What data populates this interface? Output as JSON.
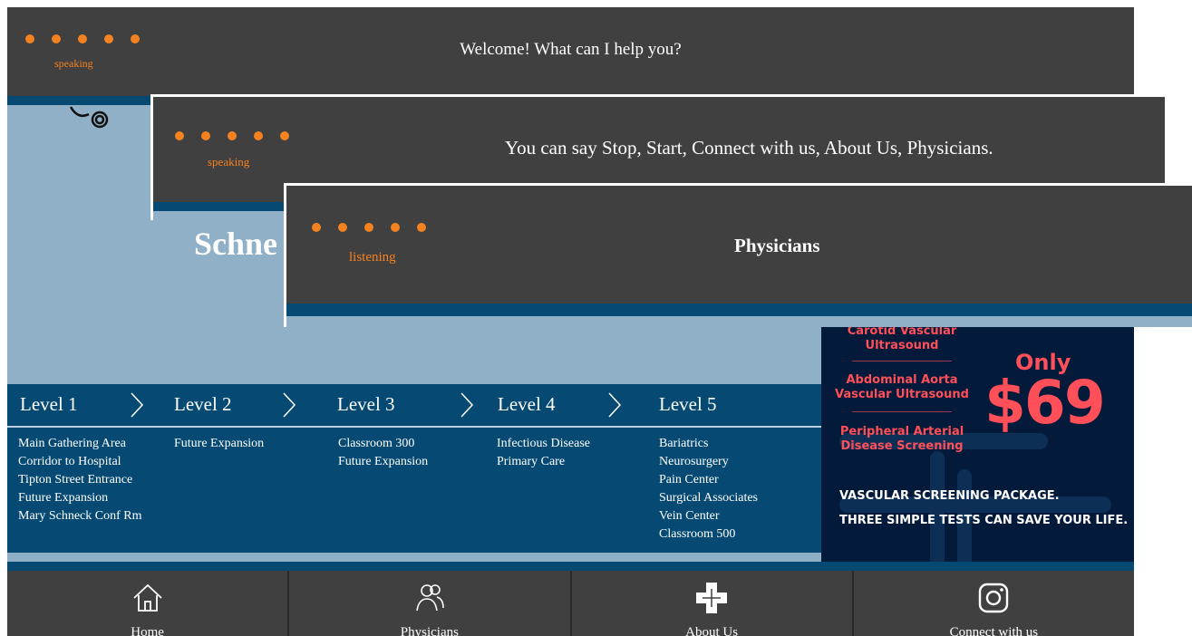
{
  "kiosk": {
    "title_partial": "Schne",
    "levels": [
      {
        "label": "Level 1",
        "items": [
          "Main Gathering Area",
          "Corridor to Hospital",
          "Tipton Street Entrance",
          "Future Expansion",
          "Mary Schneck Conf Rm"
        ]
      },
      {
        "label": "Level 2",
        "items": [
          "Future Expansion"
        ]
      },
      {
        "label": "Level 3",
        "items": [
          "Classroom 300",
          "Future Expansion"
        ]
      },
      {
        "label": "Level 4",
        "items": [
          "Infectious Disease",
          "Primary Care"
        ]
      },
      {
        "label": "Level 5",
        "items": [
          "Bariatrics",
          "Neurosurgery",
          "Pain Center",
          "Surgical Associates",
          "Vein Center",
          "Classroom 500"
        ]
      }
    ],
    "ad": {
      "tests": [
        "Carotid Vascular Ultrasound",
        "Abdominal Aorta Vascular Ultrasound",
        "Peripheral Arterial Disease Screening"
      ],
      "only": "Only",
      "price": "$69",
      "package_line1": "VASCULAR SCREENING PACKAGE.",
      "package_line2": "THREE SIMPLE TESTS CAN SAVE YOUR LIFE."
    },
    "nav": [
      {
        "label": "Home",
        "icon": "home-icon"
      },
      {
        "label": "Physicians",
        "icon": "users-icon"
      },
      {
        "label": "About Us",
        "icon": "cross-logo-icon"
      },
      {
        "label": "Connect with us",
        "icon": "instagram-icon"
      }
    ]
  },
  "dialogs": [
    {
      "status": "speaking",
      "message": "Welcome! What can I help you?"
    },
    {
      "status": "speaking",
      "message": "You can say Stop, Start, Connect with us, About Us, Physicians."
    },
    {
      "status": "listening",
      "message": "Physicians"
    }
  ],
  "colors": {
    "accent_orange": "#f58220",
    "panel_dark": "#404040",
    "navy": "#064a73",
    "light_blue": "#8fb0c6",
    "ad_red": "#ff4f58",
    "ad_bg": "#041a3a"
  }
}
